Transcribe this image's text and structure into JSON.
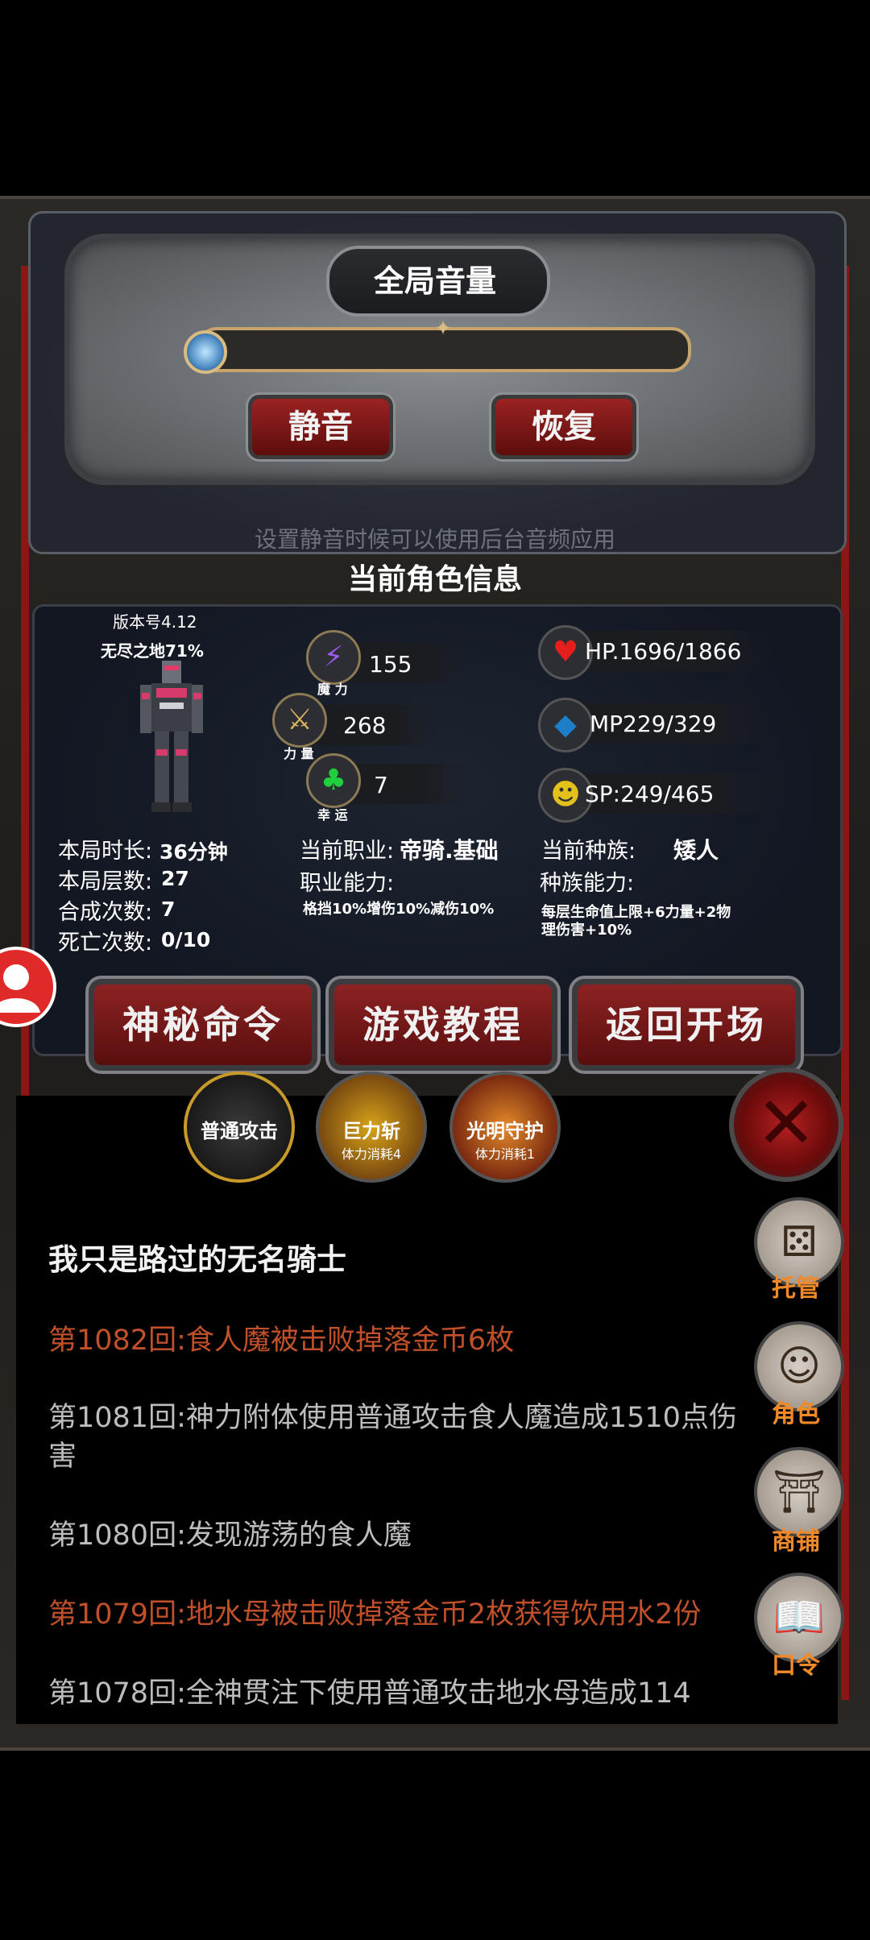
{
  "volume": {
    "title": "全局音量",
    "mute_label": "静音",
    "restore_label": "恢复",
    "hint": "设置静音时候可以使用后台音频应用",
    "level": 0
  },
  "character": {
    "section_title": "当前角色信息",
    "version": "版本号4.12",
    "progress": "无尽之地71%",
    "magic": {
      "value": "155",
      "label": "魔 力"
    },
    "strength": {
      "value": "268",
      "label": "力 量"
    },
    "luck": {
      "value": "7",
      "label": "幸 运"
    },
    "hp": "HP.1696/1866",
    "mp": "MP229/329",
    "sp": "SP:249/465",
    "duration_label": "本局时长:",
    "duration_value": "36分钟",
    "floors_label": "本局层数:",
    "floors_value": "27",
    "synth_label": "合成次数:",
    "synth_value": "7",
    "death_label": "死亡次数:",
    "death_value": "0/10",
    "job_label": "当前职业:",
    "job_value": "帝骑.基础",
    "job_ability_label": "职业能力:",
    "job_ability_value": "格挡10%增伤10%减伤10%",
    "race_label": "当前种族:",
    "race_value": "矮人",
    "race_ability_label": "种族能力:",
    "race_ability_value_1": "每层生命值上限+6力量+2物",
    "race_ability_value_2": "理伤害+10%"
  },
  "buttons": {
    "secret": "神秘命令",
    "tutorial": "游戏教程",
    "back": "返回开场"
  },
  "skills": [
    {
      "name": "普通攻击",
      "cost": ""
    },
    {
      "name": "巨力斩",
      "cost": "体力消耗4"
    },
    {
      "name": "光明守护",
      "cost": "体力消耗1"
    }
  ],
  "log": {
    "header": "我只是路过的无名骑士",
    "entries": [
      {
        "text": "第1082回:食人魔被击败掉落金币6枚",
        "color": "#c0502a"
      },
      {
        "text": "第1081回:神力附体使用普通攻击食人魔造成1510点伤害",
        "color": "#bdbdbd"
      },
      {
        "text": "第1080回:发现游荡的食人魔",
        "color": "#bdbdbd"
      },
      {
        "text": "第1079回:地水母被击败掉落金币2枚获得饮用水2份",
        "color": "#c0502a"
      },
      {
        "text": "第1078回:全神贯注下使用普通攻击地水母造成114",
        "color": "#bdbdbd"
      }
    ]
  },
  "side_menu": {
    "auto": "托管",
    "role": "角色",
    "shop": "商铺",
    "code": "口令"
  }
}
